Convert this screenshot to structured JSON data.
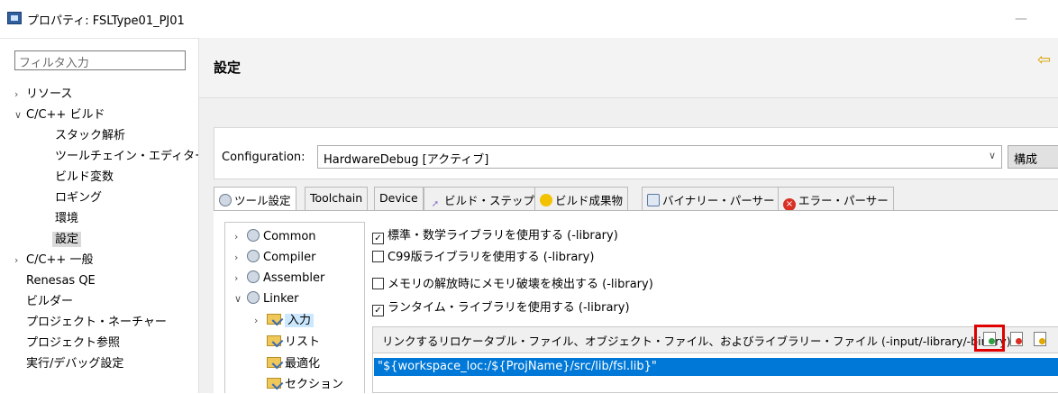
{
  "window": {
    "title": "プロパティ: FSLType01_PJ01"
  },
  "filter": {
    "placeholder": "フィルタ入力"
  },
  "nav": {
    "items": [
      {
        "label": "リソース",
        "arrow": "›"
      },
      {
        "label": "C/C++ ビルド",
        "arrow": "∨"
      },
      {
        "label": "スタック解析"
      },
      {
        "label": "ツールチェイン・エディター"
      },
      {
        "label": "ビルド変数"
      },
      {
        "label": "ロギング"
      },
      {
        "label": "環境"
      },
      {
        "label": "設定"
      },
      {
        "label": "C/C++ 一般",
        "arrow": "›"
      },
      {
        "label": "Renesas QE"
      },
      {
        "label": "ビルダー"
      },
      {
        "label": "プロジェクト・ネーチャー"
      },
      {
        "label": "プロジェクト参照"
      },
      {
        "label": "実行/デバッグ設定"
      }
    ]
  },
  "main": {
    "heading": "設定",
    "config_label": "Configuration:",
    "config_value": "HardwareDebug  [アクティブ]",
    "config_button": "構成"
  },
  "tabs": [
    {
      "label": "ツール設定"
    },
    {
      "label": "Toolchain"
    },
    {
      "label": "Device"
    },
    {
      "label": "ビルド・ステップ"
    },
    {
      "label": "ビルド成果物"
    },
    {
      "label": "バイナリー・パーサー"
    },
    {
      "label": "エラー・パーサー"
    }
  ],
  "tree": {
    "items": [
      {
        "label": "Common",
        "arrow": "›"
      },
      {
        "label": "Compiler",
        "arrow": "›"
      },
      {
        "label": "Assembler",
        "arrow": "›"
      },
      {
        "label": "Linker",
        "arrow": "∨"
      },
      {
        "label": "入力",
        "arrow": "›"
      },
      {
        "label": "リスト"
      },
      {
        "label": "最適化"
      },
      {
        "label": "セクション"
      }
    ]
  },
  "options": [
    {
      "label": "標準・数学ライブラリを使用する (-library)",
      "checked": true,
      "mark": "✓"
    },
    {
      "label": "C99版ライブラリを使用する (-library)",
      "checked": false,
      "mark": ""
    },
    {
      "label": "メモリの解放時にメモリ破壊を検出する (-library)",
      "checked": false,
      "mark": ""
    },
    {
      "label": "ランタイム・ライブラリを使用する (-library)",
      "checked": true,
      "mark": "✓"
    }
  ],
  "libs": {
    "title": "リンクするリロケータブル・ファイル、オブジェクト・ファイル、およびライブラリー・ファイル (-input/-library/-binary)",
    "entries": [
      "\"${workspace_loc:/${ProjName}/src/lib/fsl.lib}\""
    ]
  }
}
